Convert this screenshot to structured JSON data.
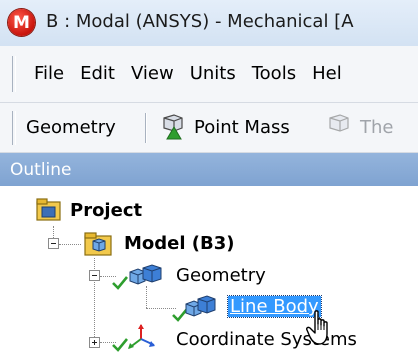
{
  "titlebar": {
    "app_icon_letter": "M",
    "title": "B : Modal (ANSYS) - Mechanical [A"
  },
  "menubar": {
    "items": [
      "File",
      "Edit",
      "View",
      "Units",
      "Tools",
      "Hel"
    ]
  },
  "toolbar": {
    "geometry_label": "Geometry",
    "point_mass_label": "Point Mass",
    "thermal_label": "The"
  },
  "outline": {
    "header": "Outline",
    "tree": {
      "project": "Project",
      "model": "Model (B3)",
      "geometry": "Geometry",
      "line_body": "Line Body",
      "coordinate_systems": "Coordinate Systems"
    }
  },
  "colors": {
    "selection": "#3399ff",
    "header": "#8aacd8",
    "check": "#2e9e2e"
  }
}
